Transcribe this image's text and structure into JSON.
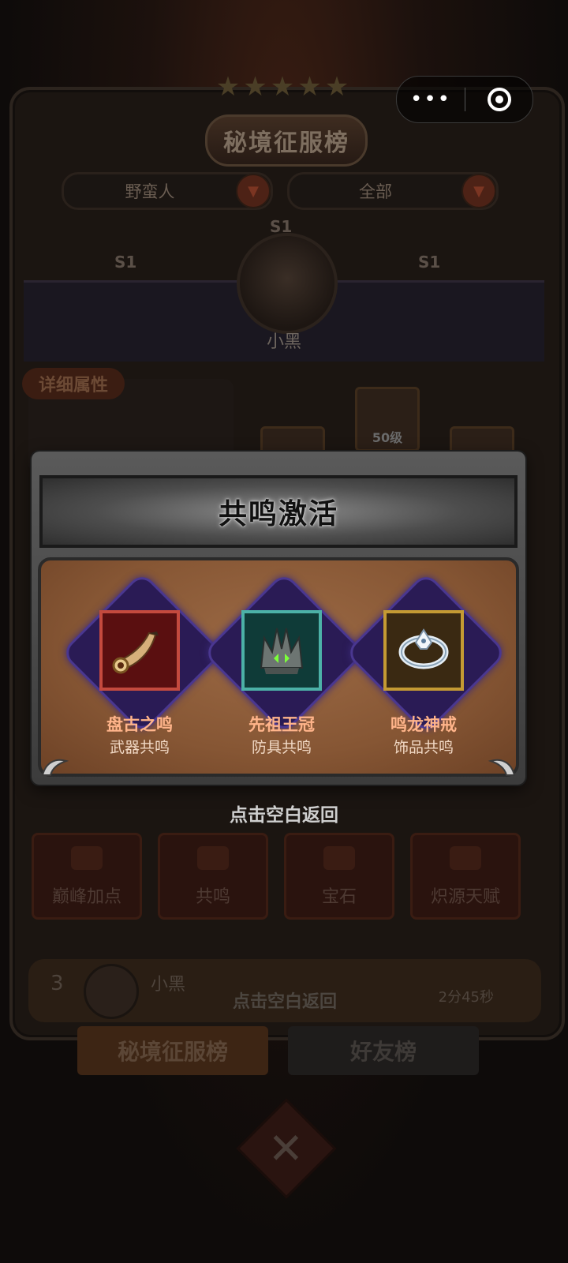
{
  "ranking": {
    "title": "秘境征服榜",
    "class_filter": "野蛮人",
    "scope_filter": "全部",
    "season_badge": "S1",
    "player_name": "小黑",
    "detail_tag": "详细属性",
    "equip_level": "50级",
    "actions": [
      "巅峰加点",
      "共鸣",
      "宝石",
      "炽源天赋"
    ],
    "bottom_entry": {
      "rank": "3",
      "name": "小黑",
      "time": "2分45秒",
      "hint": "点击空白返回"
    },
    "tabs": [
      "秘境征服榜",
      "好友榜"
    ]
  },
  "capsule": {
    "more": "•••"
  },
  "modal": {
    "title": "共鸣激活",
    "items": [
      {
        "name": "盘古之鸣",
        "type": "武器共鸣",
        "icon": "horn-icon",
        "frame_color": "#c44a3e"
      },
      {
        "name": "先祖王冠",
        "type": "防具共鸣",
        "icon": "crown-icon",
        "frame_color": "#4cb1a7"
      },
      {
        "name": "鸣龙神戒",
        "type": "饰品共鸣",
        "icon": "ring-icon",
        "frame_color": "#c49a33"
      }
    ],
    "dismiss_hint": "点击空白返回"
  }
}
